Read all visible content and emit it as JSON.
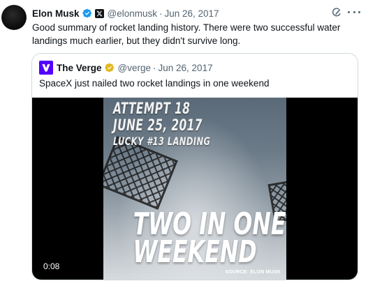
{
  "tweet": {
    "author_name": "Elon Musk",
    "handle": "@elonmusk",
    "separator": "·",
    "date": "Jun 26, 2017",
    "text": "Good summary of rocket landing history. There were two successful water landings much earlier, but they didn't survive long.",
    "icons": [
      "verified-icon",
      "x-affiliate-icon",
      "grok-icon",
      "more-icon"
    ]
  },
  "quote": {
    "author_name": "The Verge",
    "handle": "@verge",
    "separator": "·",
    "date": "Jun 26, 2017",
    "text": "SpaceX just nailed two rocket landings in one weekend",
    "video": {
      "overlay_line1": "ATTEMPT 18",
      "overlay_line2": "JUNE 25, 2017",
      "overlay_line3": "LUCKY #13 LANDING",
      "headline_line1": "TWO IN ONE",
      "headline_line2": "WEEKEND",
      "source_credit": "SOURCE: ELON MUSK",
      "timestamp": "0:08"
    }
  },
  "colors": {
    "text_primary": "#0f1419",
    "text_secondary": "#536471",
    "verified_blue": "#1d9bf0",
    "verified_gold": "#e2b719",
    "verge_purple": "#5200ff",
    "border": "#cfd9de"
  }
}
